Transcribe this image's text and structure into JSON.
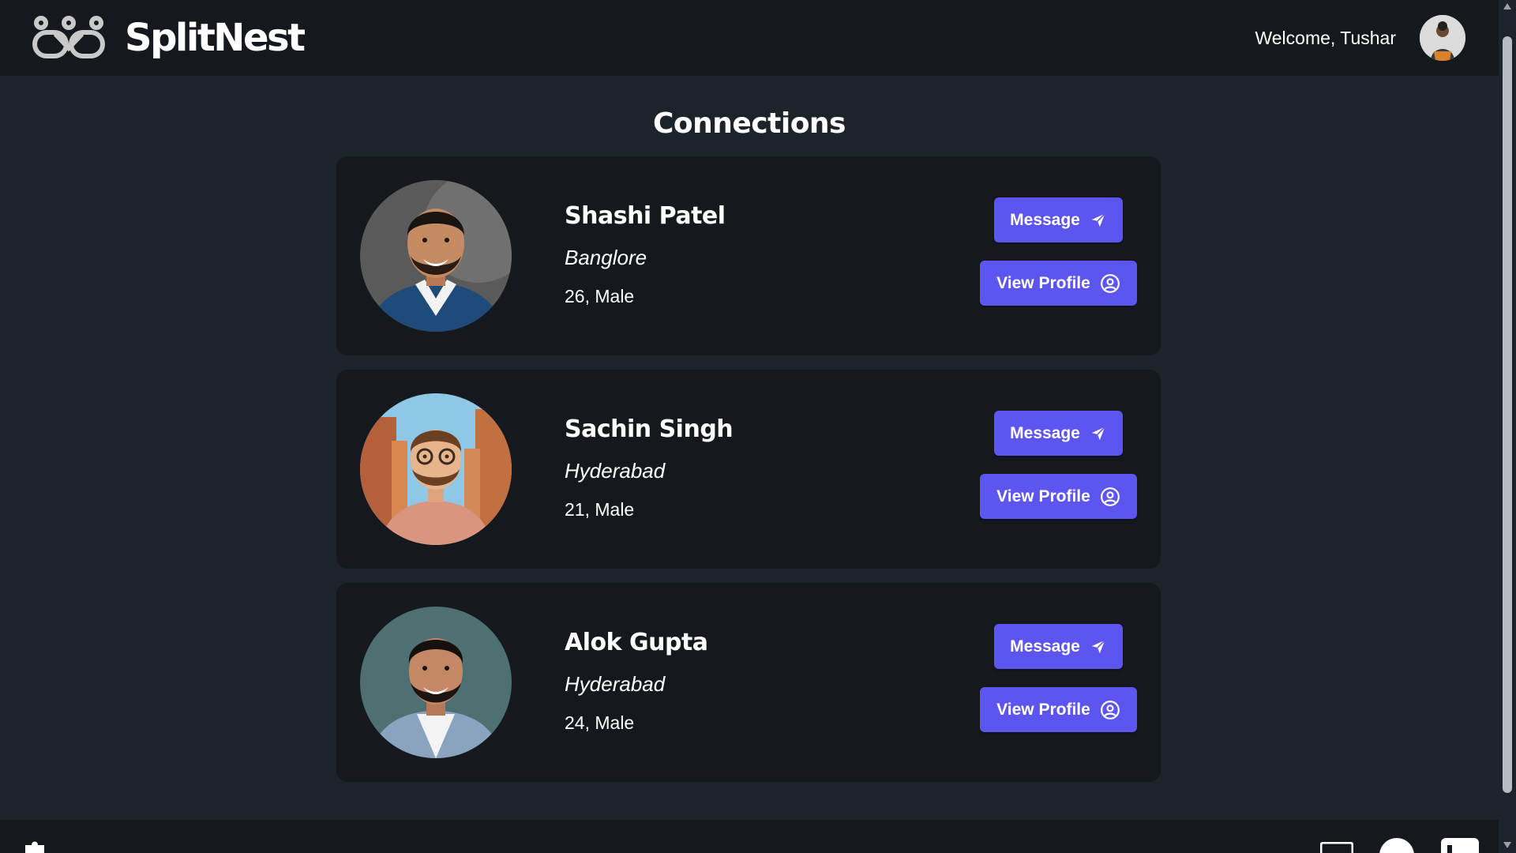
{
  "header": {
    "brand_name": "SplitNest",
    "welcome_text": "Welcome, Tushar",
    "logo_icon": "linked-chain-logo-icon",
    "avatar_icon": "user-avatar-icon"
  },
  "page": {
    "title": "Connections"
  },
  "colors": {
    "background": "#1d232a",
    "navbar": "#15191e",
    "card": "#15191e",
    "primary_button": "#5d55f0",
    "text": "#ffffff"
  },
  "connections": [
    {
      "name": "Shashi Patel",
      "city": "Banglore",
      "info": "26, Male",
      "photo_icon": "profile-photo-icon",
      "message_label": "Message",
      "view_label": "View Profile"
    },
    {
      "name": "Sachin Singh",
      "city": "Hyderabad",
      "info": "21, Male",
      "photo_icon": "profile-photo-icon",
      "message_label": "Message",
      "view_label": "View Profile"
    },
    {
      "name": "Alok Gupta",
      "city": "Hyderabad",
      "info": "24, Male",
      "photo_icon": "profile-photo-icon",
      "message_label": "Message",
      "view_label": "View Profile"
    }
  ],
  "footer": {
    "icons": [
      "puzzle-icon",
      "mail-icon",
      "github-icon",
      "linkedin-icon"
    ]
  }
}
